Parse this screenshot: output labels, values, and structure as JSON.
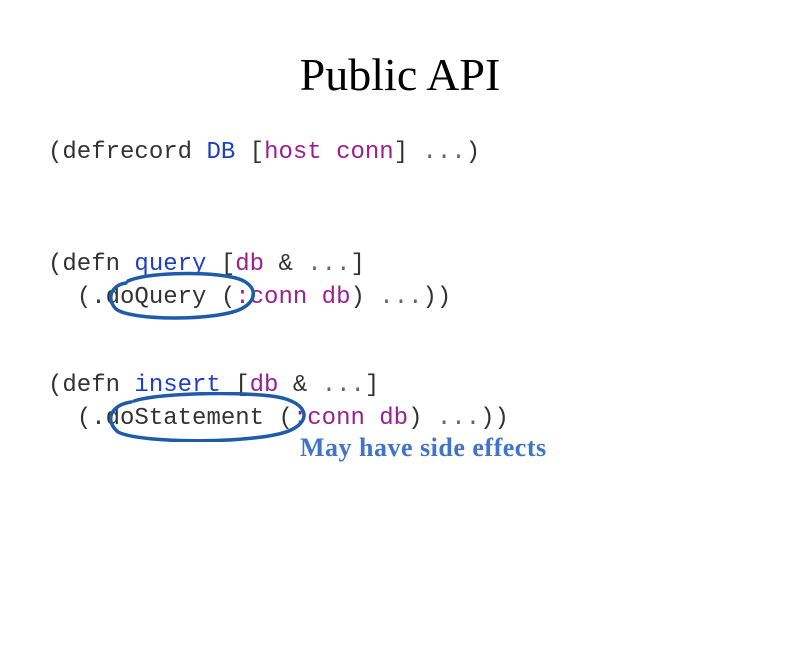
{
  "title": "Public API",
  "code1": {
    "paren1": "(",
    "kw": "defrecord",
    "space1": " ",
    "name": "DB",
    "space2": " ",
    "bracket1": "[",
    "field1": "host",
    "space3": " ",
    "field2": "conn",
    "bracket2": "]",
    "space4": " ",
    "dots": "...",
    "paren2": ")"
  },
  "code2": {
    "line1": {
      "paren1": "(",
      "kw": "defn",
      "space1": " ",
      "name": "query",
      "space2": " ",
      "bracket1": "[",
      "arg1": "db",
      "space3": " & ",
      "dots": "...",
      "bracket2": "]"
    },
    "line2": {
      "indent": "  ",
      "paren1": "(",
      "method": ".doQuery",
      "space1": " ",
      "paren2": "(",
      "kw": ":conn",
      "space2": " ",
      "arg": "db",
      "paren3": ")",
      "space3": " ",
      "dots": "...",
      "paren4": "))"
    }
  },
  "code3": {
    "line1": {
      "paren1": "(",
      "kw": "defn",
      "space1": " ",
      "name": "insert",
      "space2": " ",
      "bracket1": "[",
      "arg1": "db",
      "space3": " & ",
      "dots": "...",
      "bracket2": "]"
    },
    "line2": {
      "indent": "  ",
      "paren1": "(",
      "method": ".doStatement",
      "space1": " ",
      "paren2": "(",
      "kw": ":conn",
      "space2": " ",
      "arg": "db",
      "paren3": ")",
      "space3": " ",
      "dots": "...",
      "paren4": "))"
    }
  },
  "annotation": "May have side effects"
}
